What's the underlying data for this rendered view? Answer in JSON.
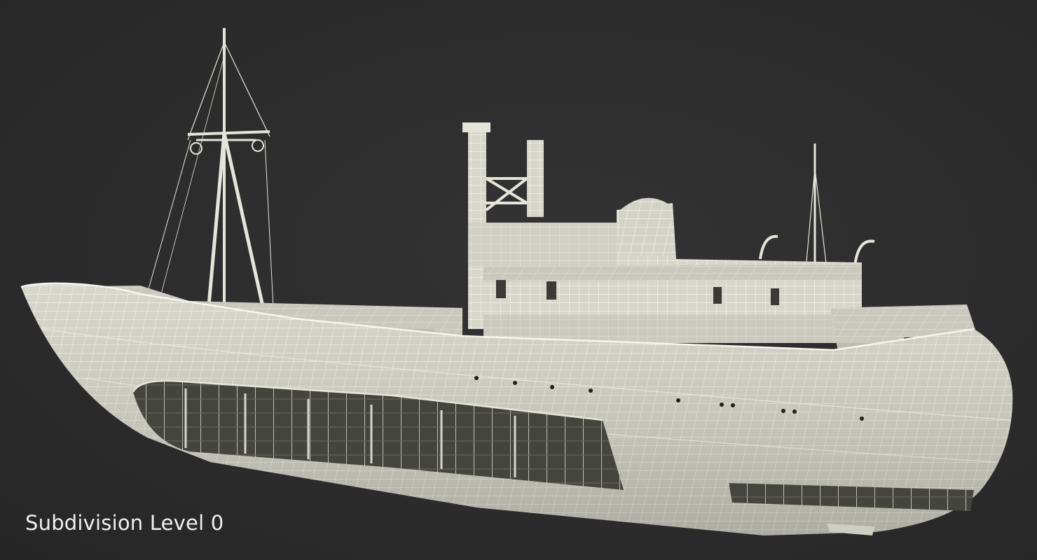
{
  "viewport": {
    "background_color": "#2b2b2b",
    "model_fill_color": "#d9d8cc",
    "model_shadow_color": "#b9b8ad",
    "wire_color": "#f4f4ee",
    "dark_interior_color": "#3a3a36"
  },
  "model": {
    "icon": "ship-wireframe-icon"
  },
  "caption": {
    "text": "Subdivision Level 0"
  }
}
